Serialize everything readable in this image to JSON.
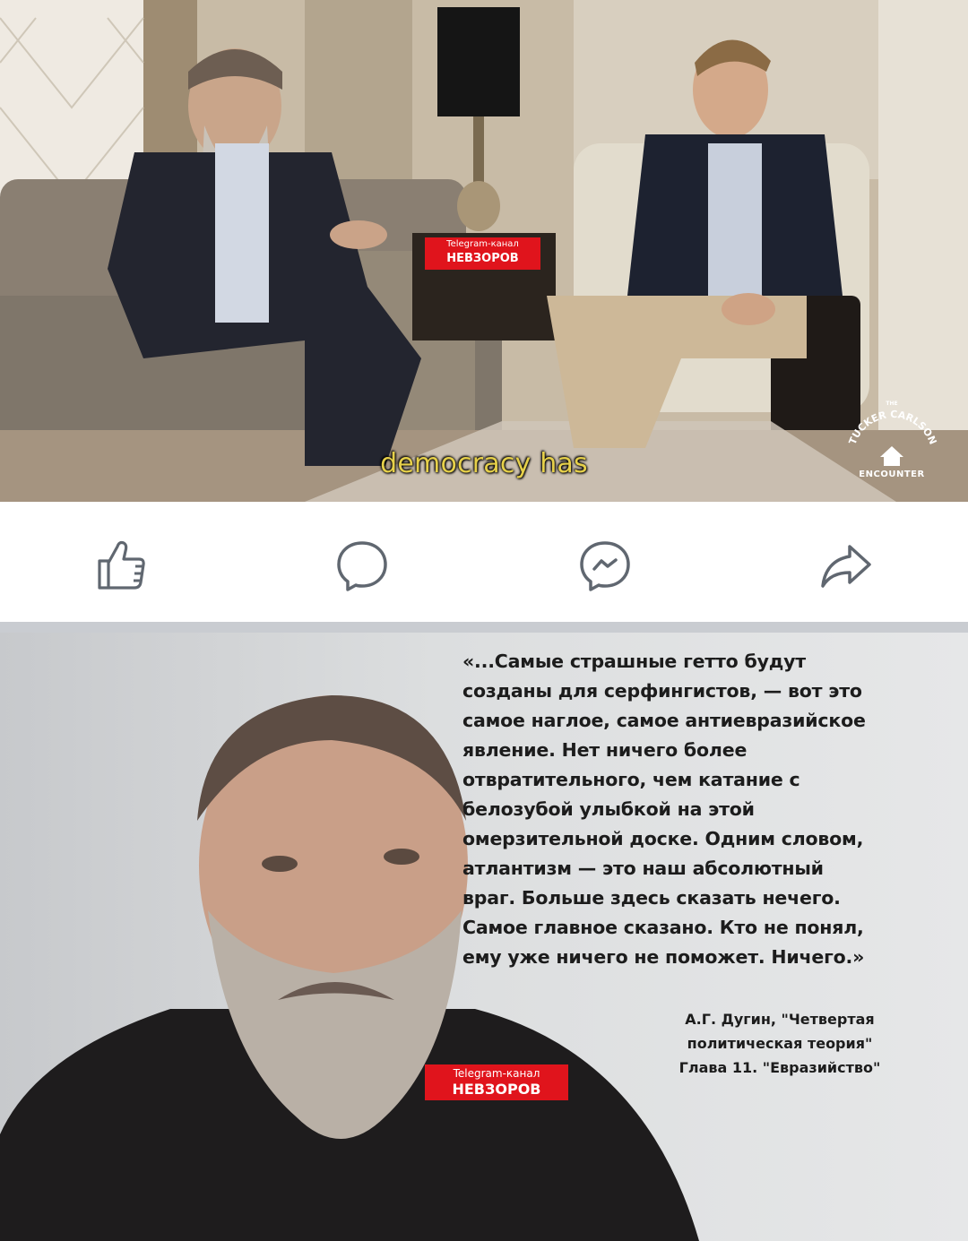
{
  "video": {
    "subtitle": "democracy has",
    "watermark": {
      "line1": "Telegram-канал",
      "line2": "НЕВЗОРОВ",
      "color": "#e0141c"
    },
    "logo": {
      "top": "THE",
      "arc": "TUCKER CARLSON",
      "bottom": "ENCOUNTER"
    }
  },
  "actions": [
    {
      "icon": "thumbs-up-icon",
      "label": "Like"
    },
    {
      "icon": "comment-icon",
      "label": "Comment"
    },
    {
      "icon": "messenger-icon",
      "label": "Send"
    },
    {
      "icon": "share-icon",
      "label": "Share"
    }
  ],
  "quote_image": {
    "quote_lines": [
      "«...Самые страшные гетто будут",
      "созданы для серфингистов, — вот это",
      "самое наглое, самое антиевразийское",
      "явление. Нет ничего более",
      "отвратительного, чем катание с",
      "белозубой улыбкой на этой",
      "омерзительной доске. Одним словом,",
      "атлантизм — это наш абсолютный",
      "враг. Больше здесь сказать нечего.",
      "Самое главное сказано. Кто не понял,",
      "ему уже ничего не поможет. Ничего.»"
    ],
    "attribution_lines": [
      "А.Г. Дугин, \"Четвертая",
      "политическая теория\"",
      "Глава 11. \"Евразийство\""
    ],
    "watermark": {
      "line1": "Telegram-канал",
      "line2": "НЕВЗОРОВ"
    }
  },
  "colors": {
    "icon_stroke": "#606770",
    "divider": "#c9ccd1",
    "subtitle": "#e6d04a"
  }
}
